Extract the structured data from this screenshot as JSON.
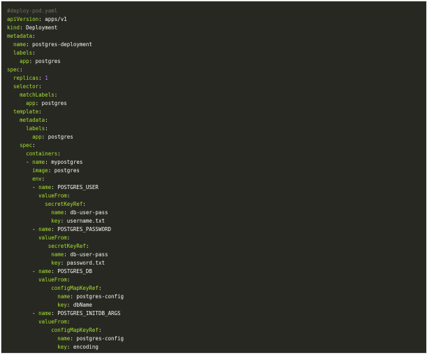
{
  "lines": [
    {
      "indent": 0,
      "comment": "#deploy-pod.yaml"
    },
    {
      "indent": 0,
      "key": "apiVersion",
      "value": "apps/v1"
    },
    {
      "indent": 0,
      "key": "kind",
      "value": "Deployment"
    },
    {
      "indent": 0,
      "key": "metadata"
    },
    {
      "indent": 2,
      "key": "name",
      "value": "postgres-deployment"
    },
    {
      "indent": 2,
      "key": "labels"
    },
    {
      "indent": 4,
      "key": "app",
      "value": "postgres"
    },
    {
      "indent": 0,
      "key": "spec"
    },
    {
      "indent": 2,
      "key": "replicas",
      "value": "1",
      "numeric": true
    },
    {
      "indent": 2,
      "key": "selector"
    },
    {
      "indent": 4,
      "key": "matchLabels"
    },
    {
      "indent": 6,
      "key": "app",
      "value": "postgres"
    },
    {
      "indent": 2,
      "key": "template"
    },
    {
      "indent": 4,
      "key": "metadata"
    },
    {
      "indent": 6,
      "key": "labels"
    },
    {
      "indent": 8,
      "key": "app",
      "value": "postgres"
    },
    {
      "indent": 4,
      "key": "spec"
    },
    {
      "indent": 6,
      "key": "containers"
    },
    {
      "indent": 6,
      "dash": true,
      "key": "name",
      "value": "mypostgres"
    },
    {
      "indent": 8,
      "key": "image",
      "value": "postgres"
    },
    {
      "indent": 8,
      "key": "env"
    },
    {
      "indent": 8,
      "dash": true,
      "key": "name",
      "value": "POSTGRES_USER"
    },
    {
      "indent": 10,
      "key": "valueFrom"
    },
    {
      "indent": 12,
      "key": "secretKeyRef"
    },
    {
      "indent": 14,
      "key": "name",
      "value": "db-user-pass"
    },
    {
      "indent": 14,
      "key": "key",
      "value": "username.txt"
    },
    {
      "indent": 8,
      "dash": true,
      "key": "name",
      "value": "POSTGRES_PASSWORD"
    },
    {
      "indent": 10,
      "key": "valueFrom"
    },
    {
      "indent": 13,
      "key": "secretKeyRef"
    },
    {
      "indent": 14,
      "key": "name",
      "value": "db-user-pass"
    },
    {
      "indent": 14,
      "key": "key",
      "value": "password.txt"
    },
    {
      "indent": 8,
      "dash": true,
      "key": "name",
      "value": "POSTGRES_DB"
    },
    {
      "indent": 10,
      "key": "valueFrom"
    },
    {
      "indent": 14,
      "key": "configMapKeyRef"
    },
    {
      "indent": 16,
      "key": "name",
      "value": "postgres-config"
    },
    {
      "indent": 16,
      "key": "key",
      "value": "dbName"
    },
    {
      "indent": 8,
      "dash": true,
      "key": "name",
      "value": "POSTGRES_INITDB_ARGS"
    },
    {
      "indent": 10,
      "key": "valueFrom"
    },
    {
      "indent": 14,
      "key": "configMapKeyRef"
    },
    {
      "indent": 16,
      "key": "name",
      "value": "postgres-config"
    },
    {
      "indent": 16,
      "key": "key",
      "value": "encoding"
    }
  ]
}
